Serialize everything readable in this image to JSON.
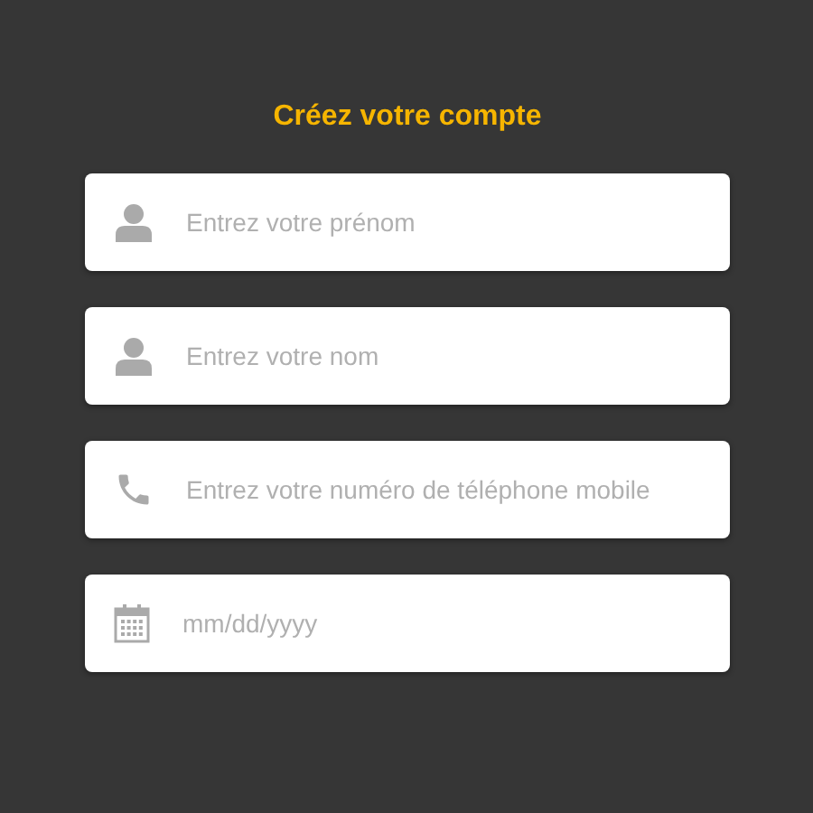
{
  "title": "Créez votre compte",
  "fields": [
    {
      "kind": "person",
      "placeholder": "Entrez votre prénom"
    },
    {
      "kind": "person",
      "placeholder": "Entrez votre nom"
    },
    {
      "kind": "phone",
      "placeholder": "Entrez votre numéro de téléphone mobile"
    },
    {
      "kind": "date",
      "placeholder": "mm/dd/yyyy"
    }
  ]
}
